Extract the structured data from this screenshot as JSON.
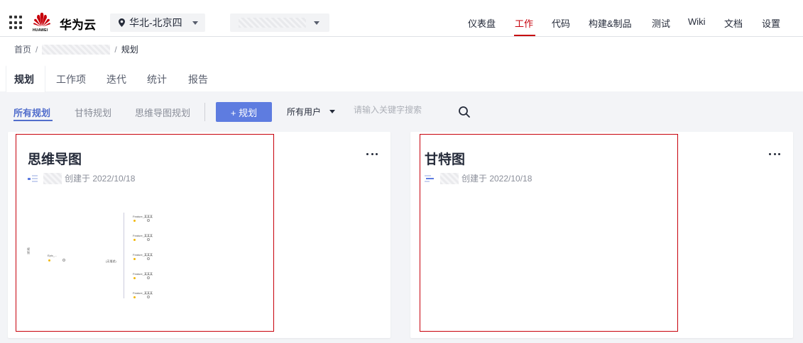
{
  "brand": {
    "name": "华为云",
    "logo_text": "HUAWEI",
    "logo_color": "#c7000b"
  },
  "region": {
    "label": "华北-北京四"
  },
  "nav": {
    "items": [
      {
        "label": "仪表盘",
        "active": false
      },
      {
        "label": "工作",
        "active": true
      },
      {
        "label": "代码",
        "active": false
      },
      {
        "label": "构建&制品",
        "active": false
      },
      {
        "label": "测试",
        "active": false
      },
      {
        "label": "Wiki",
        "active": false
      },
      {
        "label": "文档",
        "active": false
      },
      {
        "label": "设置",
        "active": false
      }
    ]
  },
  "breadcrumb": {
    "home": "首页",
    "separator": "/",
    "current": "规划"
  },
  "tabs": [
    {
      "label": "规划",
      "active": true
    },
    {
      "label": "工作项",
      "active": false
    },
    {
      "label": "迭代",
      "active": false
    },
    {
      "label": "统计",
      "active": false
    },
    {
      "label": "报告",
      "active": false
    }
  ],
  "filter": {
    "sub_tabs": [
      {
        "label": "所有规划",
        "active": true
      },
      {
        "label": "甘特规划",
        "active": false
      },
      {
        "label": "思维导图规划",
        "active": false
      }
    ],
    "add_button": "+ 规划",
    "user_filter": "所有用户",
    "search_placeholder": "请输入关键字搜索"
  },
  "cards": [
    {
      "title": "思维导图",
      "created": "创建于 2022/10/18",
      "type_icon": "mindmap-icon",
      "thumbnail": {
        "root": "Epic_...",
        "left_note": "规划",
        "center": "(无描述)",
        "branches": [
          "Feature_某某某",
          "Feature_某某某",
          "Feature_某某某",
          "Feature_某某某",
          "Feature_某某某"
        ]
      }
    },
    {
      "title": "甘特图",
      "created": "创建于 2022/10/18",
      "type_icon": "gantt-icon"
    }
  ],
  "colors": {
    "accent": "#5e7ce0",
    "active_nav": "#c7000b",
    "highlight_border": "#c7000b",
    "background": "#f3f4f7"
  }
}
